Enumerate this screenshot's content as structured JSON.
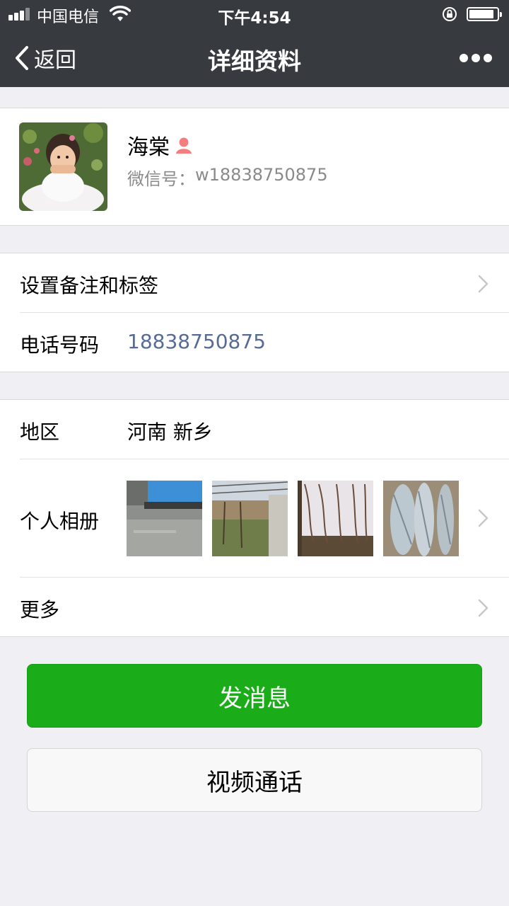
{
  "status_bar": {
    "carrier": "中国电信",
    "time": "下午4:54"
  },
  "nav": {
    "back_label": "返回",
    "title": "详细资料"
  },
  "profile": {
    "name": "海棠",
    "wechat_id_label": "微信号：",
    "wechat_id": "w18838750875"
  },
  "rows": {
    "remark_label": "设置备注和标签",
    "phone_label": "电话号码",
    "phone_value": "18838750875",
    "region_label": "地区",
    "region_value": "河南 新乡",
    "album_label": "个人相册",
    "more_label": "更多"
  },
  "buttons": {
    "send_message": "发消息",
    "video_call": "视频通话"
  },
  "colors": {
    "nav_bg": "#373a3f",
    "primary_green": "#1aad19",
    "link_blue": "#576b95",
    "page_bg": "#efeff4"
  }
}
